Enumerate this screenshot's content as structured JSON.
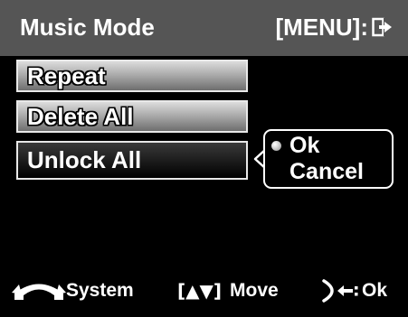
{
  "header": {
    "title": "Music Mode",
    "menu_hint": "[MENU]:",
    "exit_icon": "exit-arrow-icon"
  },
  "menu": {
    "items": [
      {
        "label": "Repeat",
        "state": "normal"
      },
      {
        "label": "Delete All",
        "state": "normal"
      },
      {
        "label": "Unlock All",
        "state": "selected"
      }
    ]
  },
  "confirm": {
    "options": [
      {
        "label": "Ok",
        "selected": true
      },
      {
        "label": "Cancel",
        "selected": false
      }
    ]
  },
  "footer": {
    "system_label": "System",
    "move_glyph": "[▲▼]",
    "move_label": "Move",
    "ok_label": "Ok",
    "icons": [
      "dial-icon",
      "enter-icon"
    ]
  },
  "colors": {
    "header_bg": "#555555",
    "screen_bg": "#000000",
    "text": "#ffffff",
    "item_gradient_top": "#dcdcdc",
    "item_gradient_bottom": "#6e6e6e"
  }
}
